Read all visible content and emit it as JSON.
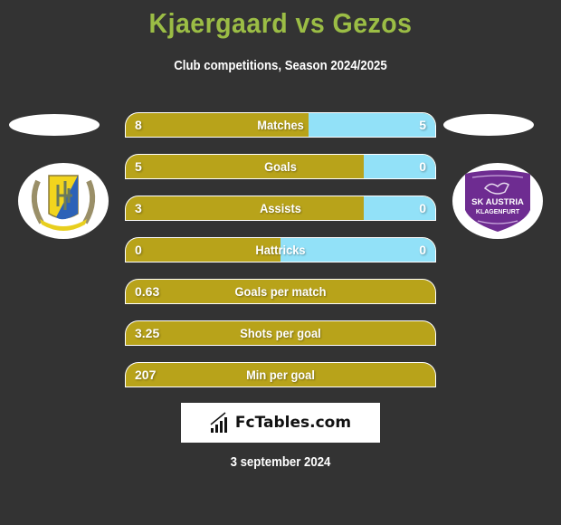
{
  "header": {
    "title": "Kjaergaard vs Gezos",
    "subtitle": "Club competitions, Season 2024/2025"
  },
  "players": {
    "left": {
      "name_oval": "",
      "club_logo": "fk-crest-logo"
    },
    "right": {
      "name_oval": "",
      "club_logo": "sk-austria-klagenfurt-logo",
      "club_text_1": "SK AUSTRIA",
      "club_text_2": "KLAGENFURT"
    }
  },
  "colors": {
    "left_bar": "#b8a31a",
    "right_bar": "#92e1f8",
    "title": "#9bbd45",
    "background": "#333333"
  },
  "stats": [
    {
      "label": "Matches",
      "left": "8",
      "right": "5",
      "right_share": 0.41
    },
    {
      "label": "Goals",
      "left": "5",
      "right": "0",
      "right_share": 0.23
    },
    {
      "label": "Assists",
      "left": "3",
      "right": "0",
      "right_share": 0.23
    },
    {
      "label": "Hattricks",
      "left": "0",
      "right": "0",
      "right_share": 0.5
    },
    {
      "label": "Goals per match",
      "left": "0.63",
      "right": "",
      "right_share": 0
    },
    {
      "label": "Shots per goal",
      "left": "3.25",
      "right": "",
      "right_share": 0
    },
    {
      "label": "Min per goal",
      "left": "207",
      "right": "",
      "right_share": 0
    }
  ],
  "brand": {
    "icon": "bar-chart-icon",
    "text": "FcTables.com"
  },
  "footer": {
    "date": "3 september 2024"
  }
}
